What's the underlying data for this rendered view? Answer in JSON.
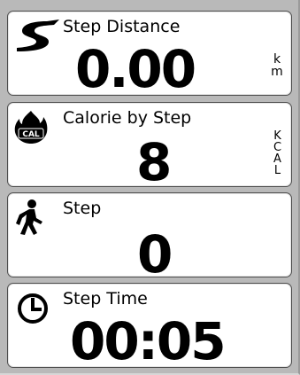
{
  "step_distance": {
    "title": "Step Distance",
    "value": "0.00",
    "unit": "km",
    "icon": "road-icon"
  },
  "calorie": {
    "title": "Calorie by Step",
    "value": "8",
    "unit": "KCAL",
    "icon": "calorie-flame-icon",
    "icon_text": "CAL"
  },
  "step": {
    "title": "Step",
    "value": "0",
    "icon": "walking-person-icon"
  },
  "step_time": {
    "title": "Step Time",
    "value": "00:05",
    "icon": "clock-icon"
  }
}
